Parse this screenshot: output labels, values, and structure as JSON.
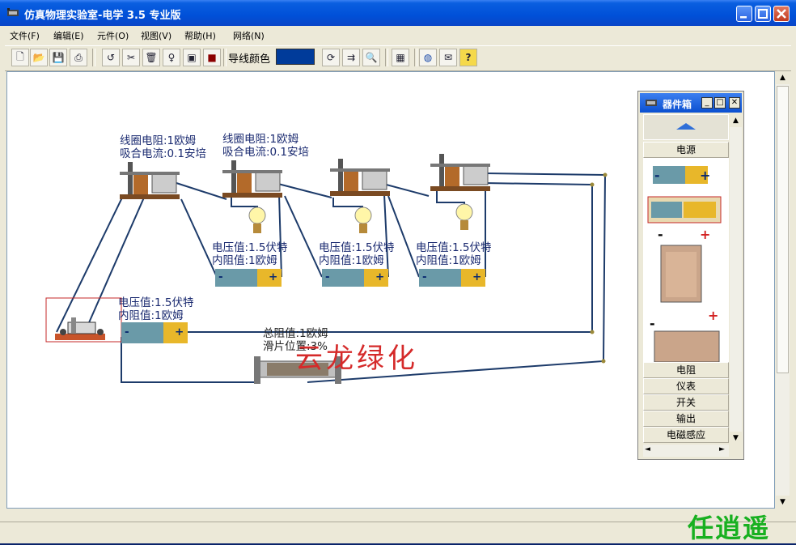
{
  "window": {
    "title": "仿真物理实验室-电学 3.5 专业版",
    "min_glyph": "_",
    "max_glyph": "□",
    "close_glyph": "✕"
  },
  "menu": [
    {
      "label": "文件(F)"
    },
    {
      "label": "编辑(E)"
    },
    {
      "label": "元件(O)"
    },
    {
      "label": "视图(V)"
    },
    {
      "label": "帮助(H)"
    },
    {
      "label": "网络(N)"
    }
  ],
  "toolbar": {
    "wire_color_label": "导线颜色",
    "wire_color": "#003b9a",
    "buttons": [
      {
        "name": "new-file-icon",
        "glyph": "🗋"
      },
      {
        "name": "open-folder-icon",
        "glyph": "📂"
      },
      {
        "name": "save-disk-icon",
        "glyph": "💾"
      },
      {
        "name": "print-icon",
        "glyph": "⎙"
      },
      {
        "name": "undo-icon",
        "glyph": "↺"
      },
      {
        "name": "tools-icon",
        "glyph": "✂"
      },
      {
        "name": "trash-icon",
        "glyph": "🗑"
      },
      {
        "name": "bulb-icon",
        "glyph": "♀"
      },
      {
        "name": "image-icon",
        "glyph": "▣"
      },
      {
        "name": "stop-icon",
        "glyph": "■"
      },
      {
        "name": "rotate-icon",
        "glyph": "⟳"
      },
      {
        "name": "split-icon",
        "glyph": "⇉"
      },
      {
        "name": "zoom-icon",
        "glyph": "🔍"
      },
      {
        "name": "calculator-icon",
        "glyph": "▦"
      },
      {
        "name": "globe-icon",
        "glyph": "◍"
      },
      {
        "name": "mail-icon",
        "glyph": "✉"
      },
      {
        "name": "help-icon",
        "glyph": "?"
      }
    ]
  },
  "circuit": {
    "relay_labels": [
      {
        "line1": "线圈电阻:1欧姆",
        "line2": "吸合电流:0.1安培"
      },
      {
        "line1": "线圈电阻:1欧姆",
        "line2": "吸合电流:0.1安培"
      }
    ],
    "battery_labels": [
      {
        "line1": "电压值:1.5伏特",
        "line2": "内阻值:1欧姆"
      },
      {
        "line1": "电压值:1.5伏特",
        "line2": "内阻值:1欧姆"
      },
      {
        "line1": "电压值:1.5伏特",
        "line2": "内阻值:1欧姆"
      },
      {
        "line1": "电压值:1.5伏特",
        "line2": "内阻值:1欧姆"
      }
    ],
    "rheostat_label": {
      "line1": "总阻值:1欧姆",
      "line2": "滑片位置:3%"
    },
    "battery_minus": "-",
    "battery_plus": "+"
  },
  "watermarks": {
    "red": "云龙绿化",
    "green": "任逍遥"
  },
  "toolbox": {
    "title": "器件箱",
    "min_glyph": "_",
    "max_glyph": "□",
    "close_glyph": "✕",
    "active_category": "电源",
    "categories": [
      "电阻",
      "仪表",
      "开关",
      "输出",
      "电磁感应"
    ],
    "scroll_up": "▲",
    "scroll_down": "▼",
    "scroll_left": "◄",
    "scroll_right": "►"
  },
  "scrollbar": {
    "up": "▲",
    "down": "▼"
  }
}
